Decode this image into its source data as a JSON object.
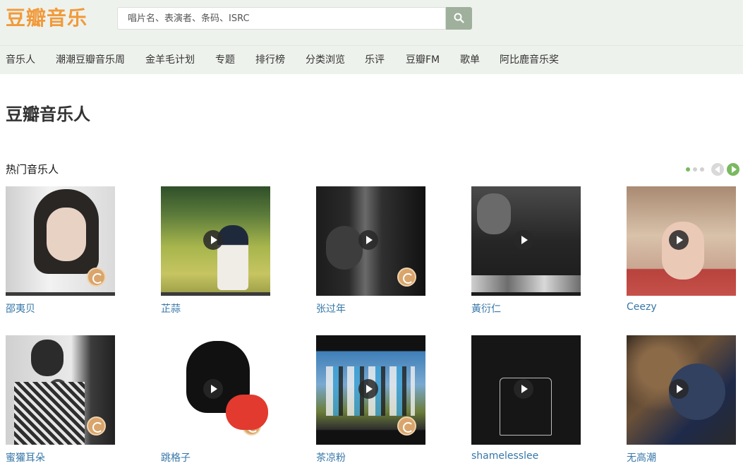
{
  "header": {
    "logo": "豆瓣音乐",
    "search_placeholder": "唱片名、表演者、条码、ISRC"
  },
  "nav": [
    {
      "label": "音乐人"
    },
    {
      "label": "潮潮豆瓣音乐周"
    },
    {
      "label": "金羊毛计划"
    },
    {
      "label": "专题"
    },
    {
      "label": "排行榜"
    },
    {
      "label": "分类浏览"
    },
    {
      "label": "乐评"
    },
    {
      "label": "豆瓣FM"
    },
    {
      "label": "歌单"
    },
    {
      "label": "阿比鹿音乐奖"
    }
  ],
  "page_title": "豆瓣音乐人",
  "section": {
    "title": "热门音乐人",
    "pager": {
      "dots": 3,
      "active_dot": 1
    }
  },
  "artists": [
    {
      "name": "邵夷贝",
      "image": "woman-covering-face-photo",
      "badge": true
    },
    {
      "name": "芷蒜",
      "image": "grass-field-photo",
      "badge": false
    },
    {
      "name": "张过年",
      "image": "man-by-tree-photo",
      "badge": true
    },
    {
      "name": "黃衍仁",
      "image": "guitarist-singing-photo",
      "badge": false
    },
    {
      "name": "Ceezy",
      "image": "baby-photo",
      "badge": false
    },
    {
      "name": "蜜獾耳朵",
      "image": "man-in-plaid-shirt-photo",
      "badge": true
    },
    {
      "name": "跳格子",
      "image": "girl-line-drawing",
      "badge": true
    },
    {
      "name": "茶凉粉",
      "image": "band-group-photo",
      "badge": true
    },
    {
      "name": "shamelesslee",
      "image": "shirt-line-art",
      "badge": false
    },
    {
      "name": "无高潮",
      "image": "live-band-photo",
      "badge": false
    }
  ],
  "colors": {
    "logo": "#f19a3b",
    "header_bg": "#eef2ec",
    "link": "#3677a8",
    "pager_active": "#7ab95f",
    "search_button": "#9fb09c"
  }
}
